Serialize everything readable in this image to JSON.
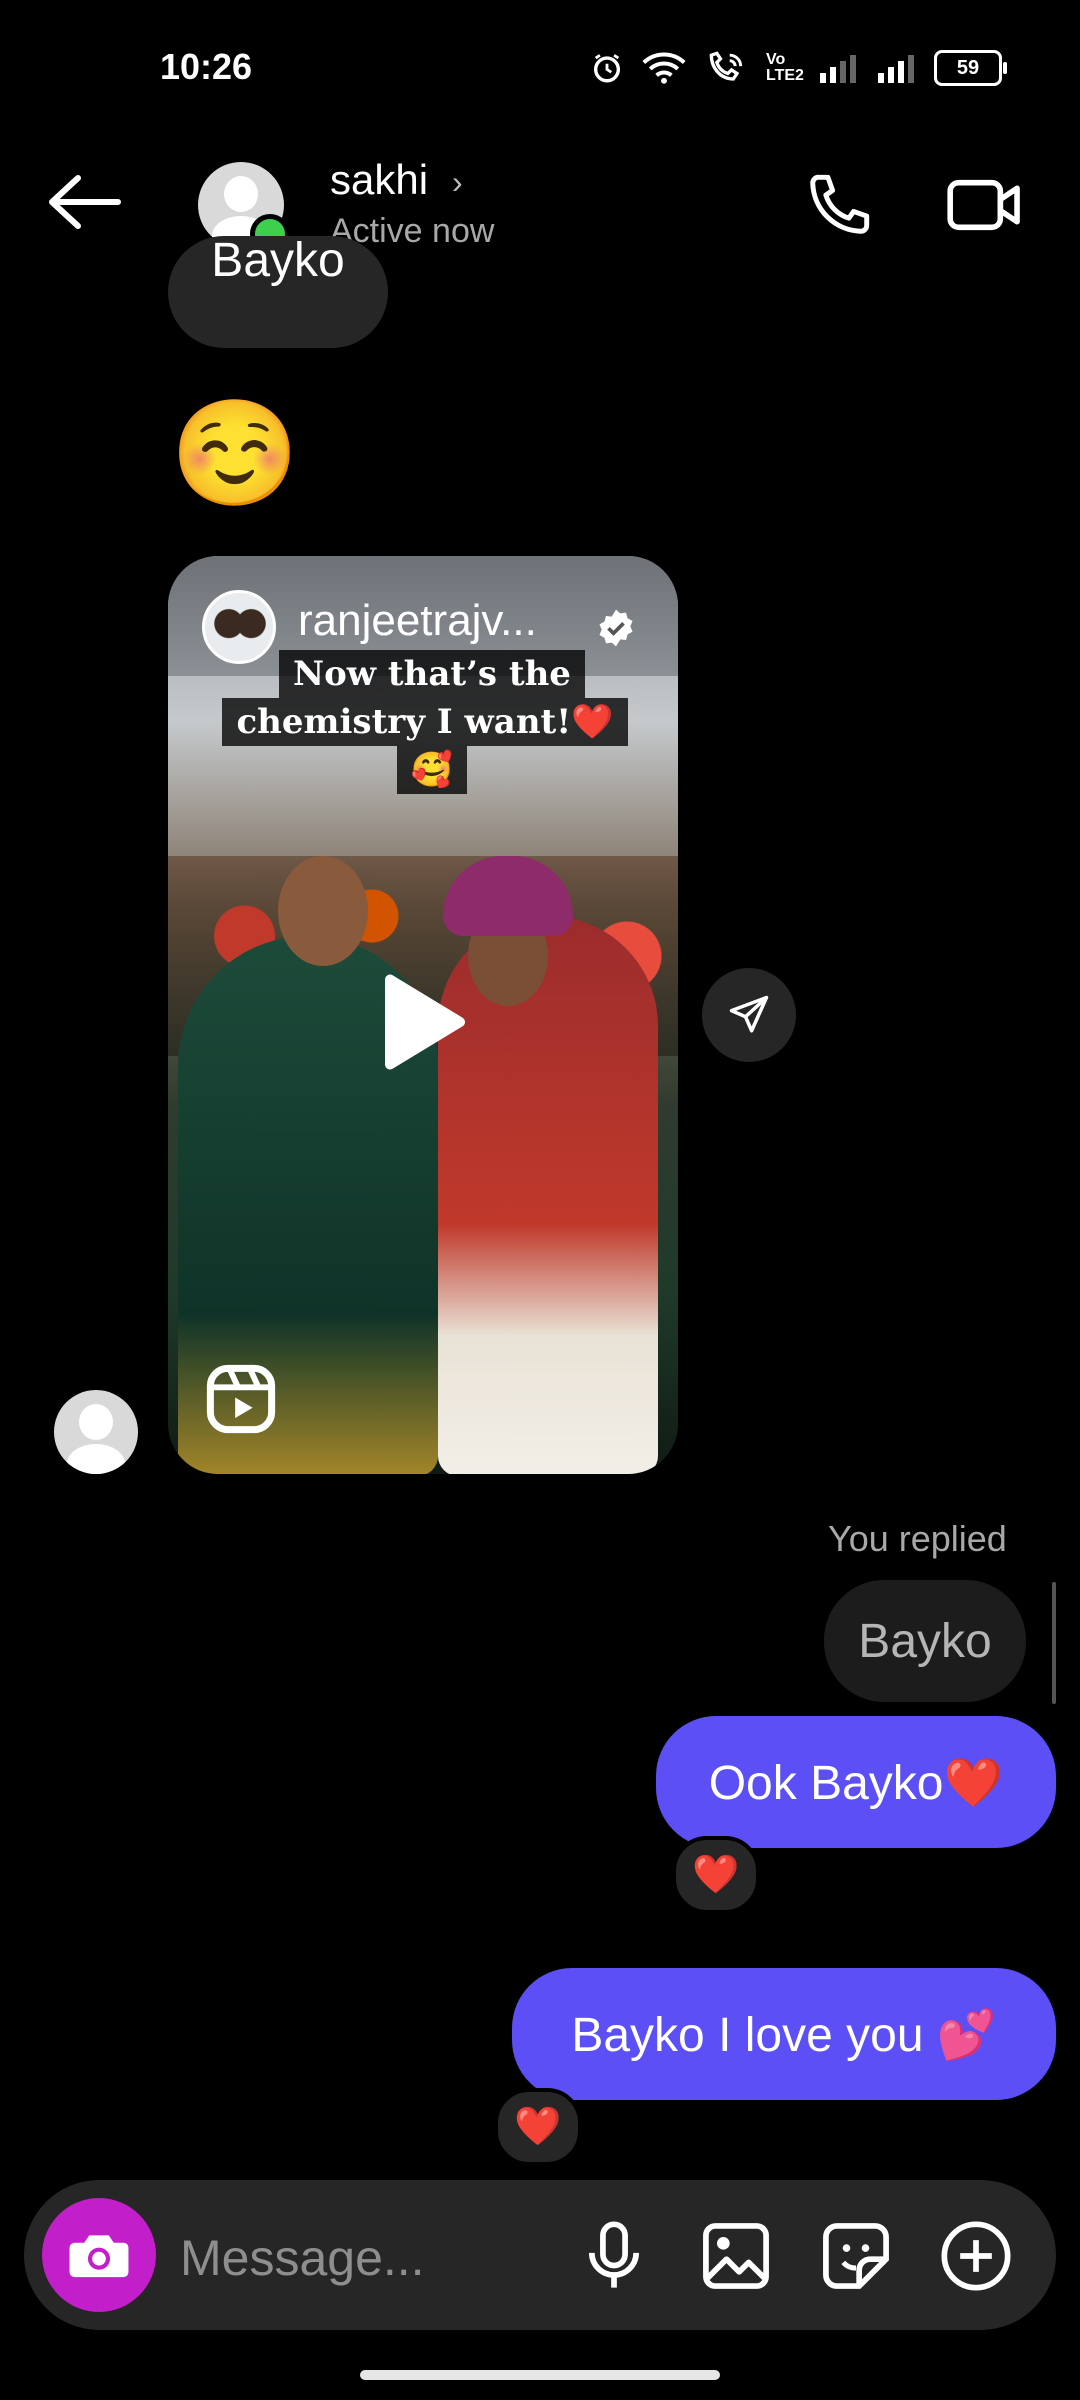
{
  "status_bar": {
    "time": "10:26",
    "battery": "59",
    "network_label": "Vo LTE2"
  },
  "header": {
    "contact_name": "sakhi",
    "chevron": "›",
    "status": "Active now",
    "icons": [
      "back-arrow-icon",
      "phone-icon",
      "video-camera-icon"
    ]
  },
  "messages": {
    "partial_bubble": "Bayko",
    "emoji": "☺️",
    "reel": {
      "owner": "ranjeetrajv...",
      "caption_line1": "Now that’s the",
      "caption_line2": "chemistry I want!❤️🥰"
    },
    "you_replied": "You replied",
    "replied_to": "Bayko",
    "sent_1": "Ook Bayko❤️",
    "sent_1_reaction": "❤️",
    "sent_2": "Bayko I love you 💕",
    "sent_2_reaction": "❤️"
  },
  "composer": {
    "placeholder": "Message...",
    "icons": [
      "camera-icon",
      "microphone-icon",
      "gallery-icon",
      "sticker-icon",
      "plus-icon"
    ]
  },
  "colors": {
    "background": "#000000",
    "sent_bubble": "#5b4ff5",
    "received_bubble": "#262626",
    "camera_button": "#c21ec9",
    "online": "#3ecf4c"
  }
}
